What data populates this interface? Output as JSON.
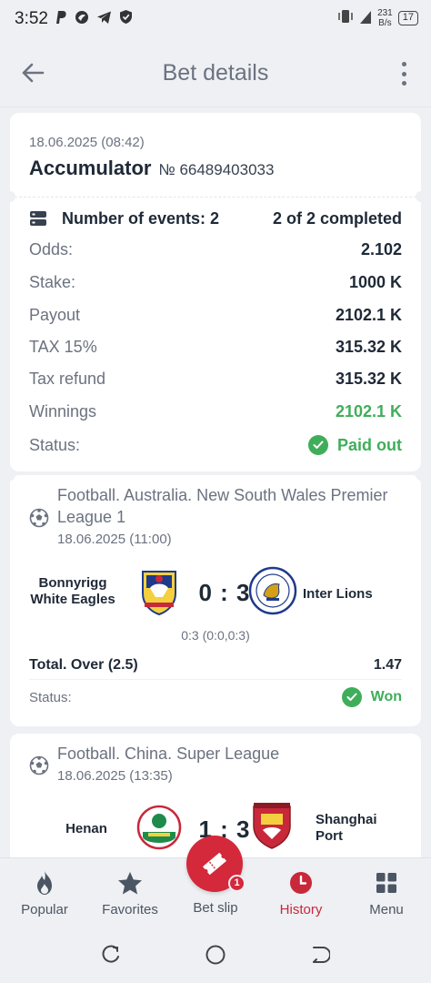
{
  "status_bar": {
    "time": "3:52",
    "speed_value": "231",
    "speed_unit": "B/s",
    "battery": "17"
  },
  "header": {
    "title": "Bet details"
  },
  "bet": {
    "date": "18.06.2025 (08:42)",
    "type": "Accumulator",
    "number": "№ 66489403033",
    "events_label": "Number of events: 2",
    "completed": "2 of 2 completed",
    "rows": [
      {
        "label": "Odds:",
        "value": "2.102"
      },
      {
        "label": "Stake:",
        "value": "1000 K"
      },
      {
        "label": "Payout",
        "value": "2102.1 K"
      },
      {
        "label": "TAX 15%",
        "value": "315.32 K"
      },
      {
        "label": "Tax refund",
        "value": "315.32 K"
      },
      {
        "label": "Winnings",
        "value": "2102.1 K"
      }
    ],
    "status_label": "Status:",
    "status_value": "Paid out"
  },
  "events": [
    {
      "league": "Football. Australia. New South Wales Premier League 1",
      "date": "18.06.2025 (11:00)",
      "home": "Bonnyrigg White Eagles",
      "away": "Inter Lions",
      "score": "0 : 3",
      "detail": "0:3 (0:0,0:3)",
      "market": "Total. Over (2.5)",
      "odds": "1.47",
      "status_label": "Status:",
      "status_value": "Won"
    },
    {
      "league": "Football. China. Super League",
      "date": "18.06.2025 (13:35)",
      "home": "Henan",
      "away": "Shanghai Port",
      "score": "1 : 3"
    }
  ],
  "nav": {
    "items": [
      {
        "label": "Popular",
        "icon": "flame-icon"
      },
      {
        "label": "Favorites",
        "icon": "star-icon"
      },
      {
        "label": "Bet slip",
        "icon": "ticket-icon"
      },
      {
        "label": "History",
        "icon": "clock-icon"
      },
      {
        "label": "Menu",
        "icon": "grid-icon"
      }
    ],
    "betslip_count": "1",
    "active": "History"
  },
  "colors": {
    "accent_red": "#d4283b",
    "success_green": "#3fae5a",
    "background": "#eef0f3"
  }
}
